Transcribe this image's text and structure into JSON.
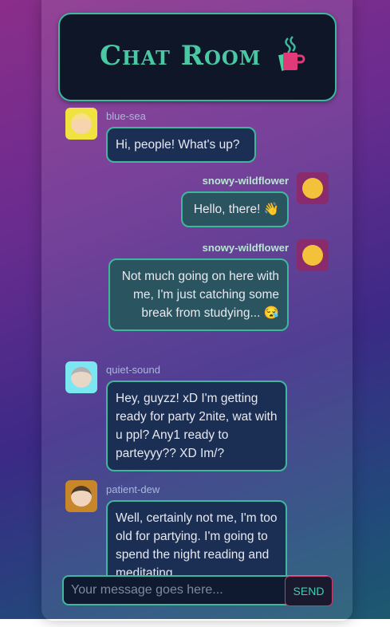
{
  "header": {
    "title": "Chat Room",
    "icon": "coffee-cup-icon"
  },
  "messages": [
    {
      "user": "blue-sea",
      "mine": false,
      "avatar_color": "#f0e341",
      "avatar_icon": "blond-person-emoji",
      "text": "Hi, people! What's up?"
    },
    {
      "user": "snowy-wildflower",
      "mine": true,
      "avatar_color": "#8a2b6e",
      "avatar_icon": "dizzy-face-emoji",
      "text": "Hello, there! 👋"
    },
    {
      "user": "snowy-wildflower",
      "mine": true,
      "avatar_color": "#8a2b6e",
      "avatar_icon": "dizzy-face-emoji",
      "text": "Not much going on here with me, I'm just catching some break from studying... 😪"
    },
    {
      "user": "quiet-sound",
      "mine": false,
      "avatar_color": "#7be7f0",
      "avatar_icon": "person-facepalming-emoji",
      "text": "Hey, guyzz! xD I'm getting ready for party 2nite, wat with u ppl? Any1 ready to parteyyy?? XD Im/?"
    },
    {
      "user": "patient-dew",
      "mine": false,
      "avatar_color": "#c8862a",
      "avatar_icon": "person-tipping-hand-emoji",
      "text": "Well, certainly not me, I'm too old for partying. I'm going to spend the night reading and meditating..."
    }
  ],
  "composer": {
    "placeholder": "Your message goes here...",
    "value": ""
  },
  "send": {
    "label": "SEND"
  },
  "colors": {
    "accent": "#3fb79d",
    "bubble_other": "#1b2f55",
    "bubble_mine": "#2a5560",
    "send_border": "#c93a6a"
  }
}
